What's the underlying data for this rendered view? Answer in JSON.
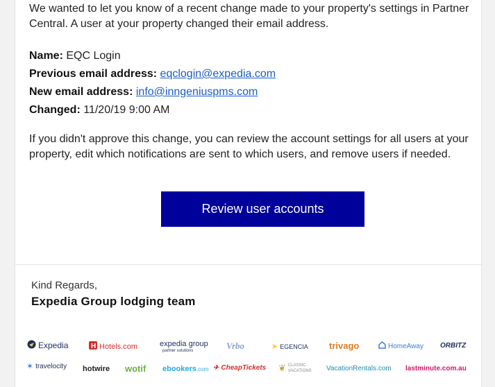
{
  "email": {
    "intro": "We wanted to let you know of a recent change made to your property's settings in Partner Central. A user at your property changed their email address.",
    "details": {
      "name_label": "Name:",
      "name_value": "EQC Login",
      "prev_label": "Previous email address:",
      "prev_value": "eqclogin@expedia.com",
      "new_label": "New email address:",
      "new_value": "info@inngeniuspms.com",
      "changed_label": "Changed:",
      "changed_value": "11/20/19 9:00 AM"
    },
    "advice": "If you didn't approve this change, you can review the account settings for all users at your property, edit which notifications are sent to which users, and remove users if needed.",
    "cta_label": "Review user accounts",
    "regards": "Kind Regards,",
    "team": "Expedia Group lodging team"
  },
  "brands": {
    "expedia": "Expedia",
    "hotels": "Hotels.com",
    "expedia_group": "expedia group",
    "expedia_group_sub": "partner solutions",
    "vrbo": "Vrbo",
    "egencia": "EGENCIA",
    "trivago": "trivago",
    "homeaway": "HomeAway",
    "orbitz": "ORBITZ",
    "travelocity": "travelocity",
    "hotwire": "hotwire",
    "wotif": "wotif",
    "ebookers": "ebookers",
    "ebookers_suffix": ".com",
    "cheaptickets": "CheapTickets",
    "classic": "CLASSIC",
    "classic_sub": "VACATIONS",
    "vacationrentals": "VacationRentals.com",
    "lastminute": "lastminute.com.au"
  },
  "colors": {
    "cta_bg": "#00009b",
    "link": "#1a5ec2",
    "page_bg": "#f2f2f2"
  }
}
